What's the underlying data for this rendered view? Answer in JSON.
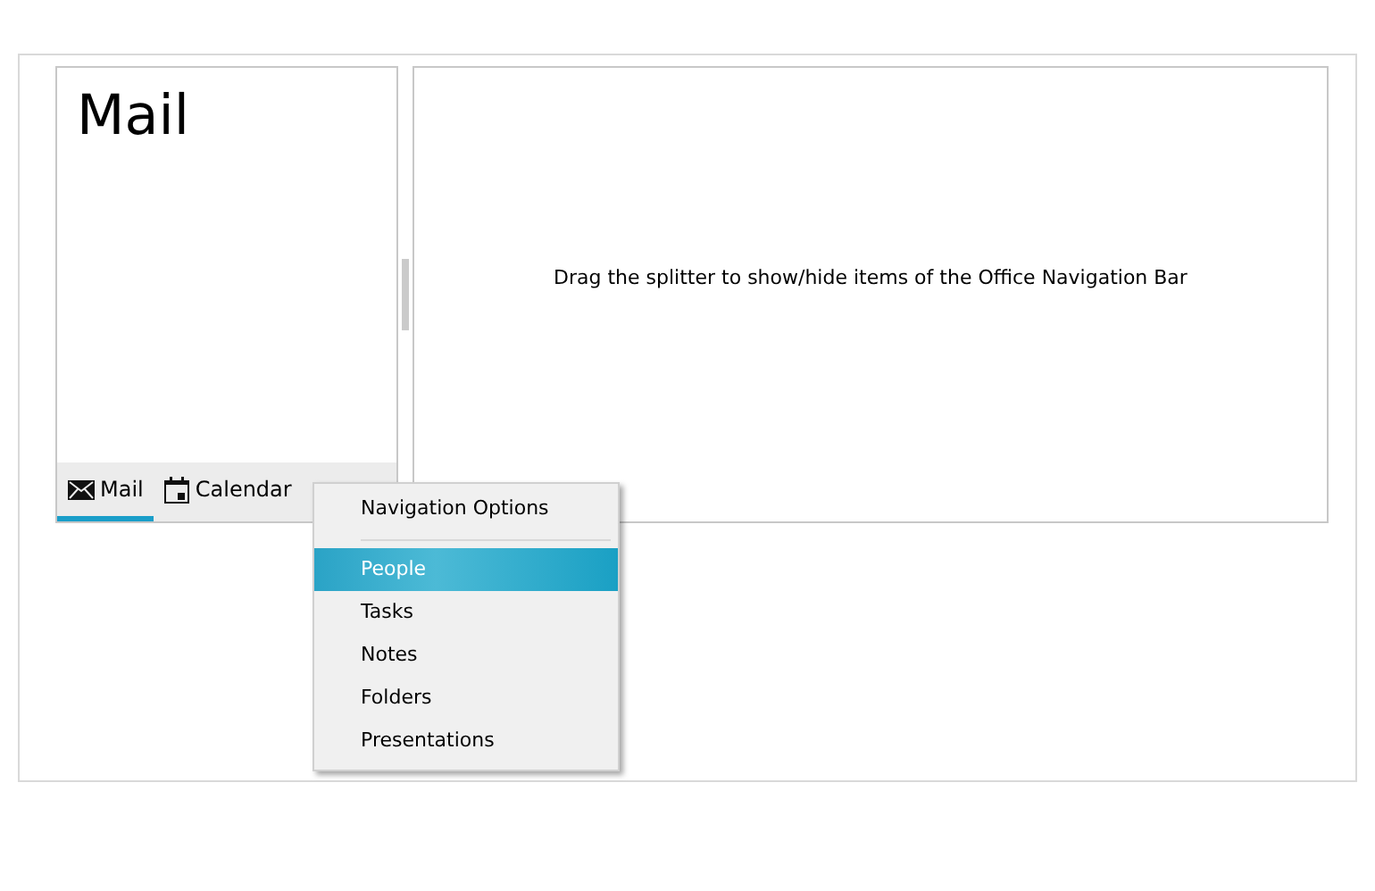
{
  "pane": {
    "title": "Mail"
  },
  "nav_items": [
    {
      "label": "Mail",
      "kind": "mail",
      "selected": true
    },
    {
      "label": "Calendar",
      "kind": "calendar",
      "selected": false
    }
  ],
  "content": {
    "message": "Drag the splitter to show/hide items of the Office Navigation Bar"
  },
  "menu": {
    "header": "Navigation Options",
    "items": [
      {
        "label": "People",
        "selected": true
      },
      {
        "label": "Tasks",
        "selected": false
      },
      {
        "label": "Notes",
        "selected": false
      },
      {
        "label": "Folders",
        "selected": false
      },
      {
        "label": "Presentations",
        "selected": false
      }
    ]
  }
}
